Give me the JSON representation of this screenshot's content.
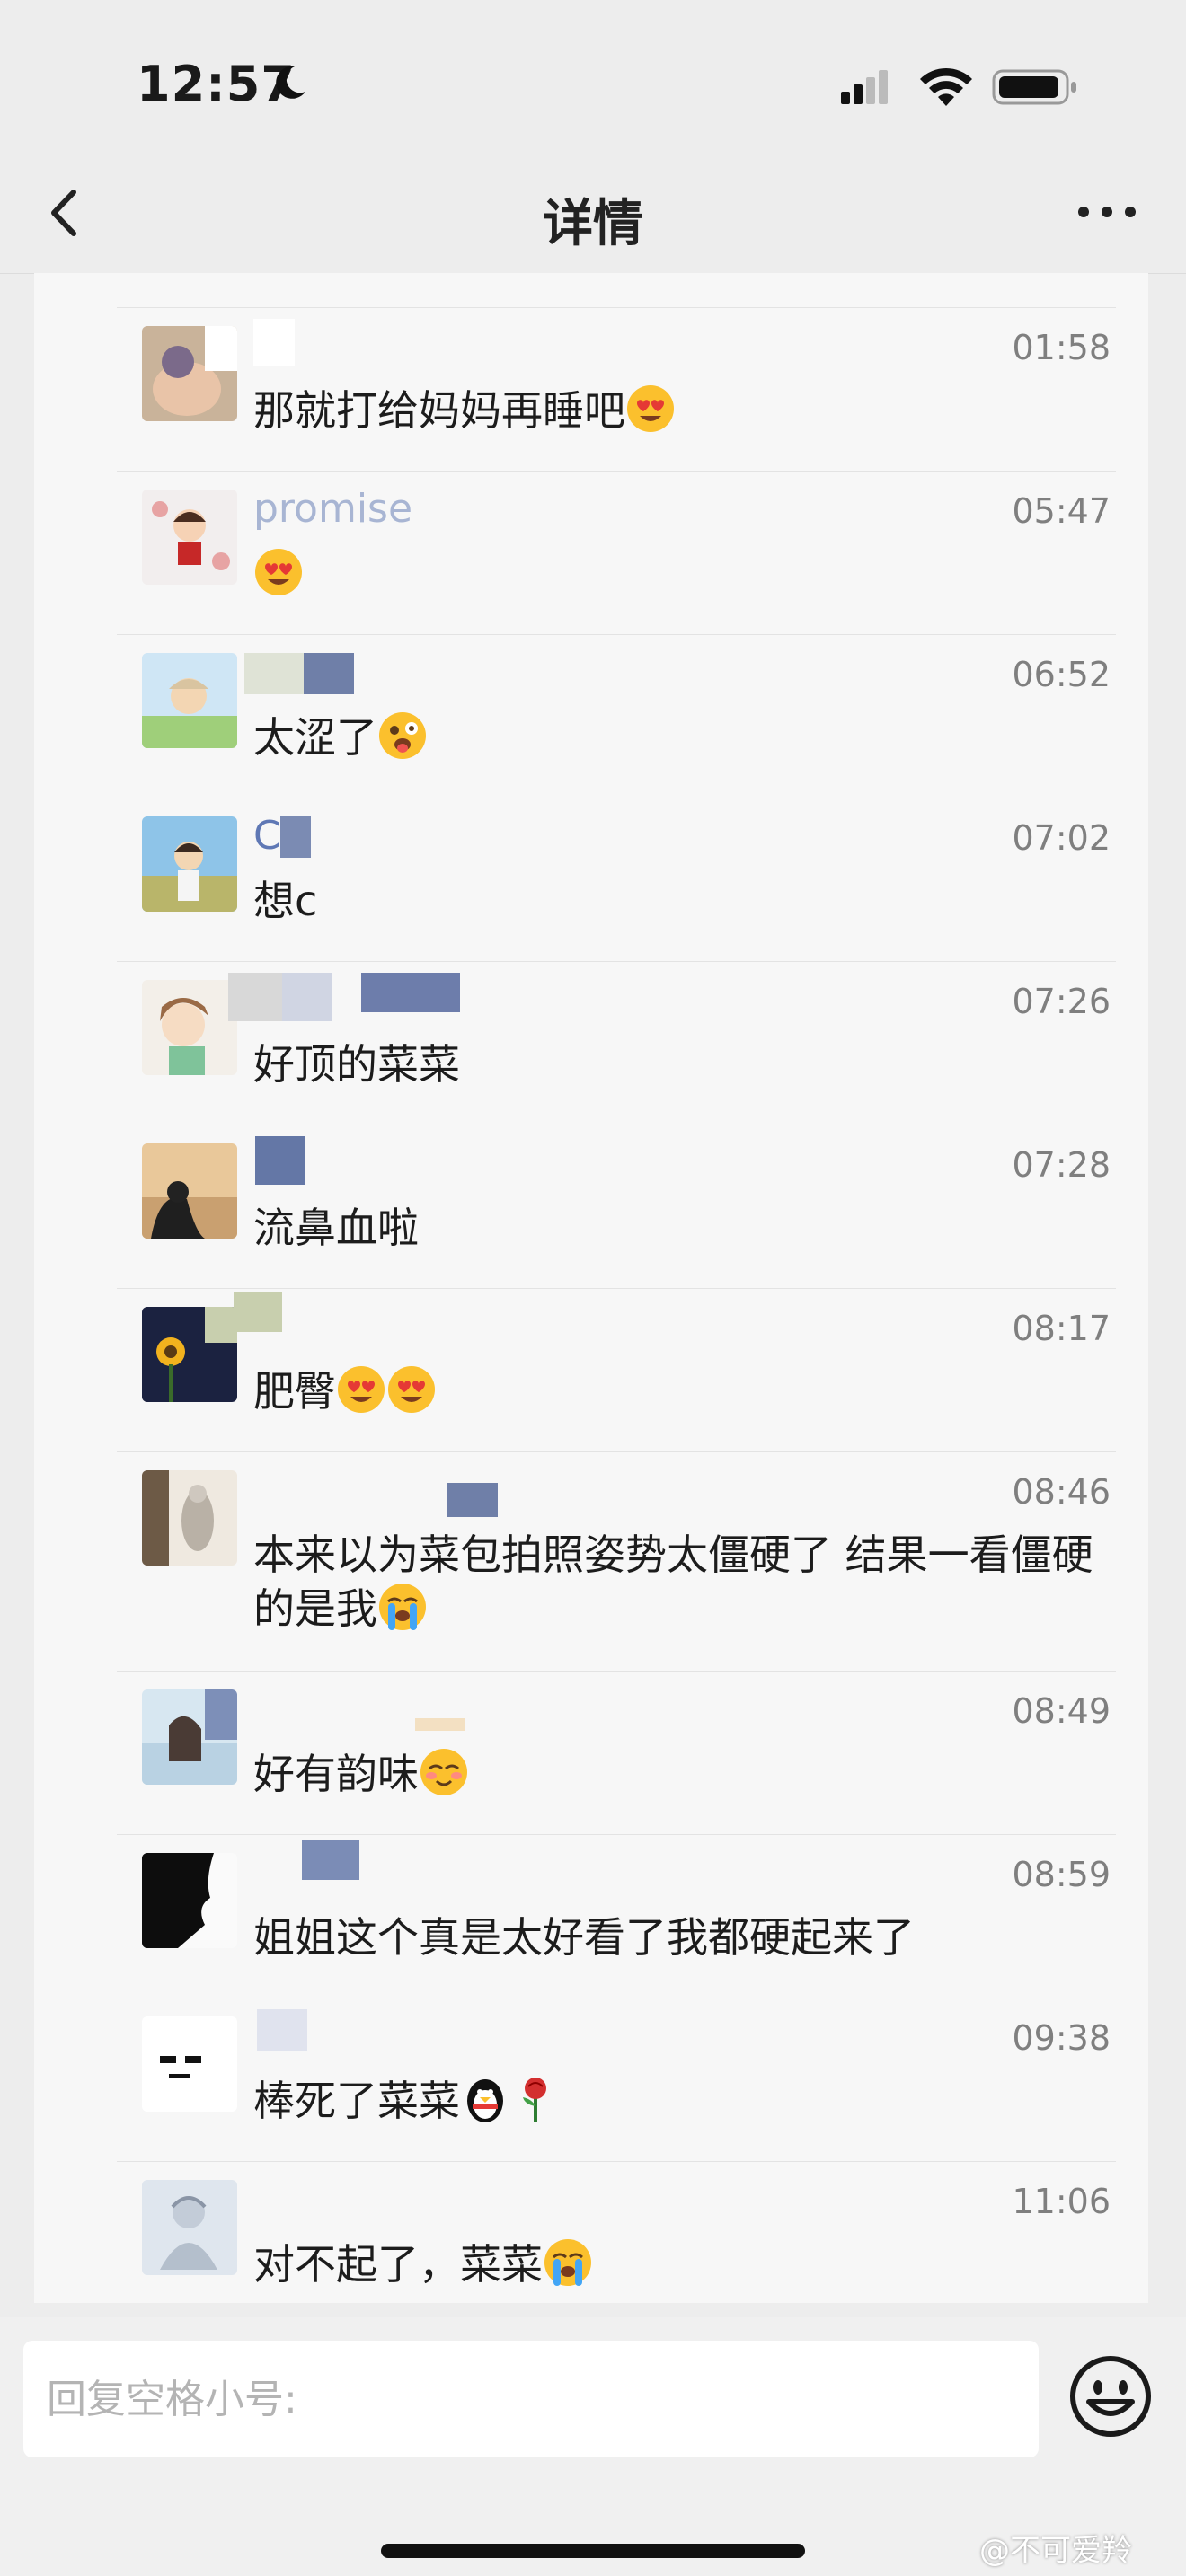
{
  "status_bar": {
    "time": "12:57"
  },
  "header": {
    "title": "详情"
  },
  "comments": [
    {
      "username": "",
      "time": "01:58",
      "text": "那就打给妈妈再睡吧",
      "emojis": [
        "heart-eyes-emoji"
      ]
    },
    {
      "username": "promise",
      "time": "05:47",
      "text": "",
      "emojis": [
        "heart-eyes-emoji"
      ]
    },
    {
      "username": "",
      "time": "06:52",
      "text": "太涩了",
      "emojis": [
        "tongue-emoji"
      ]
    },
    {
      "username": "C",
      "time": "07:02",
      "text": "想c",
      "emojis": []
    },
    {
      "username": "",
      "time": "07:26",
      "text": "好顶的菜菜",
      "emojis": []
    },
    {
      "username": "",
      "time": "07:28",
      "text": "流鼻血啦",
      "emojis": []
    },
    {
      "username": "",
      "time": "08:17",
      "text": "肥臀",
      "emojis": [
        "heart-eyes-emoji",
        "heart-eyes-emoji"
      ]
    },
    {
      "username": "",
      "time": "08:46",
      "text": "本来以为菜包拍照姿势太僵硬了 结果一看僵硬的是我",
      "emojis": [
        "crying-emoji"
      ]
    },
    {
      "username": "",
      "time": "08:49",
      "text": "好有韵味",
      "emojis": [
        "blush-emoji"
      ]
    },
    {
      "username": "",
      "time": "08:59",
      "text": "姐姐这个真是太好看了我都硬起来了",
      "emojis": []
    },
    {
      "username": "",
      "time": "09:38",
      "text": "棒死了菜菜",
      "emojis": [
        "penguin-emoji",
        "rose-emoji"
      ]
    },
    {
      "username": "",
      "time": "11:06",
      "text": "对不起了，菜菜",
      "emojis": [
        "crying-emoji"
      ]
    }
  ],
  "reply": {
    "placeholder": "回复空格小号:"
  },
  "watermark": "@不可爱羚",
  "colors": {
    "background": "#ededed",
    "panel": "#f7f7f7",
    "time_text": "#7f7f7f",
    "username_blur": "#8ea0c8"
  }
}
